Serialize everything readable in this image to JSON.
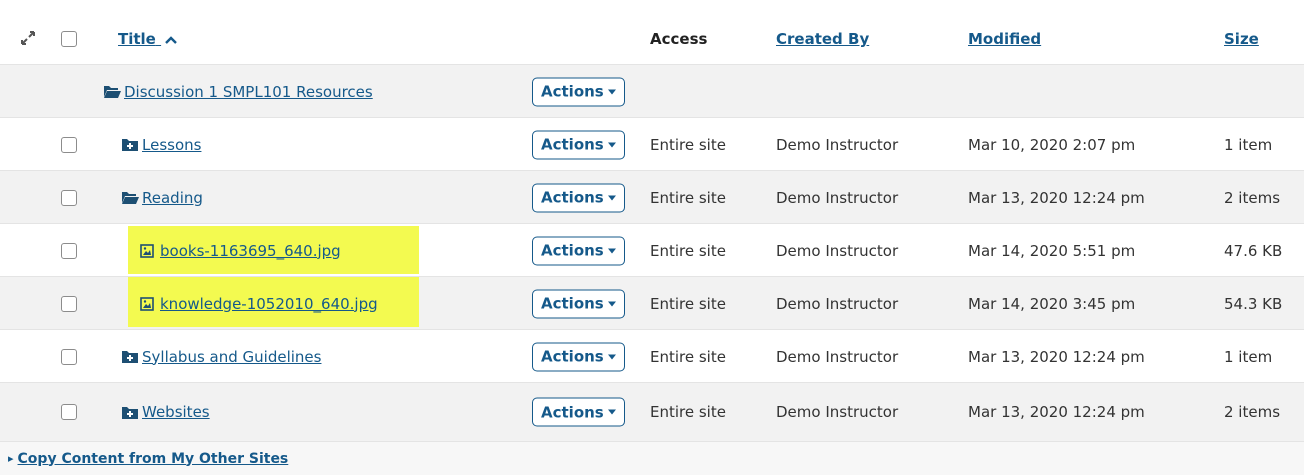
{
  "header": {
    "expand_icon": "expand-arrows-icon",
    "title_label": "Title",
    "sort_arrow": "▲",
    "access_label": "Access",
    "created_by_label": "Created By",
    "modified_label": "Modified",
    "size_label": "Size"
  },
  "actions_label": "Actions",
  "parent_folder": {
    "name": "Discussion 1 SMPL101 Resources",
    "icon": "folder-open-icon"
  },
  "rows": [
    {
      "name": "Lessons",
      "icon": "folder-plus-icon",
      "access": "Entire site",
      "created_by": "Demo Instructor",
      "modified": "Mar 10, 2020 2:07 pm",
      "size": "1 item"
    },
    {
      "name": "Reading",
      "icon": "folder-open-icon",
      "access": "Entire site",
      "created_by": "Demo Instructor",
      "modified": "Mar 13, 2020 12:24 pm",
      "size": "2 items"
    },
    {
      "name": "books-1163695_640.jpg",
      "icon": "image-file-icon",
      "access": "Entire site",
      "created_by": "Demo Instructor",
      "modified": "Mar 14, 2020 5:51 pm",
      "size": "47.6 KB"
    },
    {
      "name": "knowledge-1052010_640.jpg",
      "icon": "image-file-icon",
      "access": "Entire site",
      "created_by": "Demo Instructor",
      "modified": "Mar 14, 2020 3:45 pm",
      "size": "54.3 KB"
    },
    {
      "name": "Syllabus and Guidelines",
      "icon": "folder-plus-icon",
      "access": "Entire site",
      "created_by": "Demo Instructor",
      "modified": "Mar 13, 2020 12:24 pm",
      "size": "1 item"
    },
    {
      "name": "Websites",
      "icon": "folder-plus-icon",
      "access": "Entire site",
      "created_by": "Demo Instructor",
      "modified": "Mar 13, 2020 12:24 pm",
      "size": "2 items"
    }
  ],
  "footer": {
    "copy_content_label": "Copy Content from My Other Sites",
    "arrow": "▸"
  },
  "colors": {
    "link": "#15598a",
    "highlight": "#f3fa50",
    "alt_row": "#f2f2f2"
  }
}
